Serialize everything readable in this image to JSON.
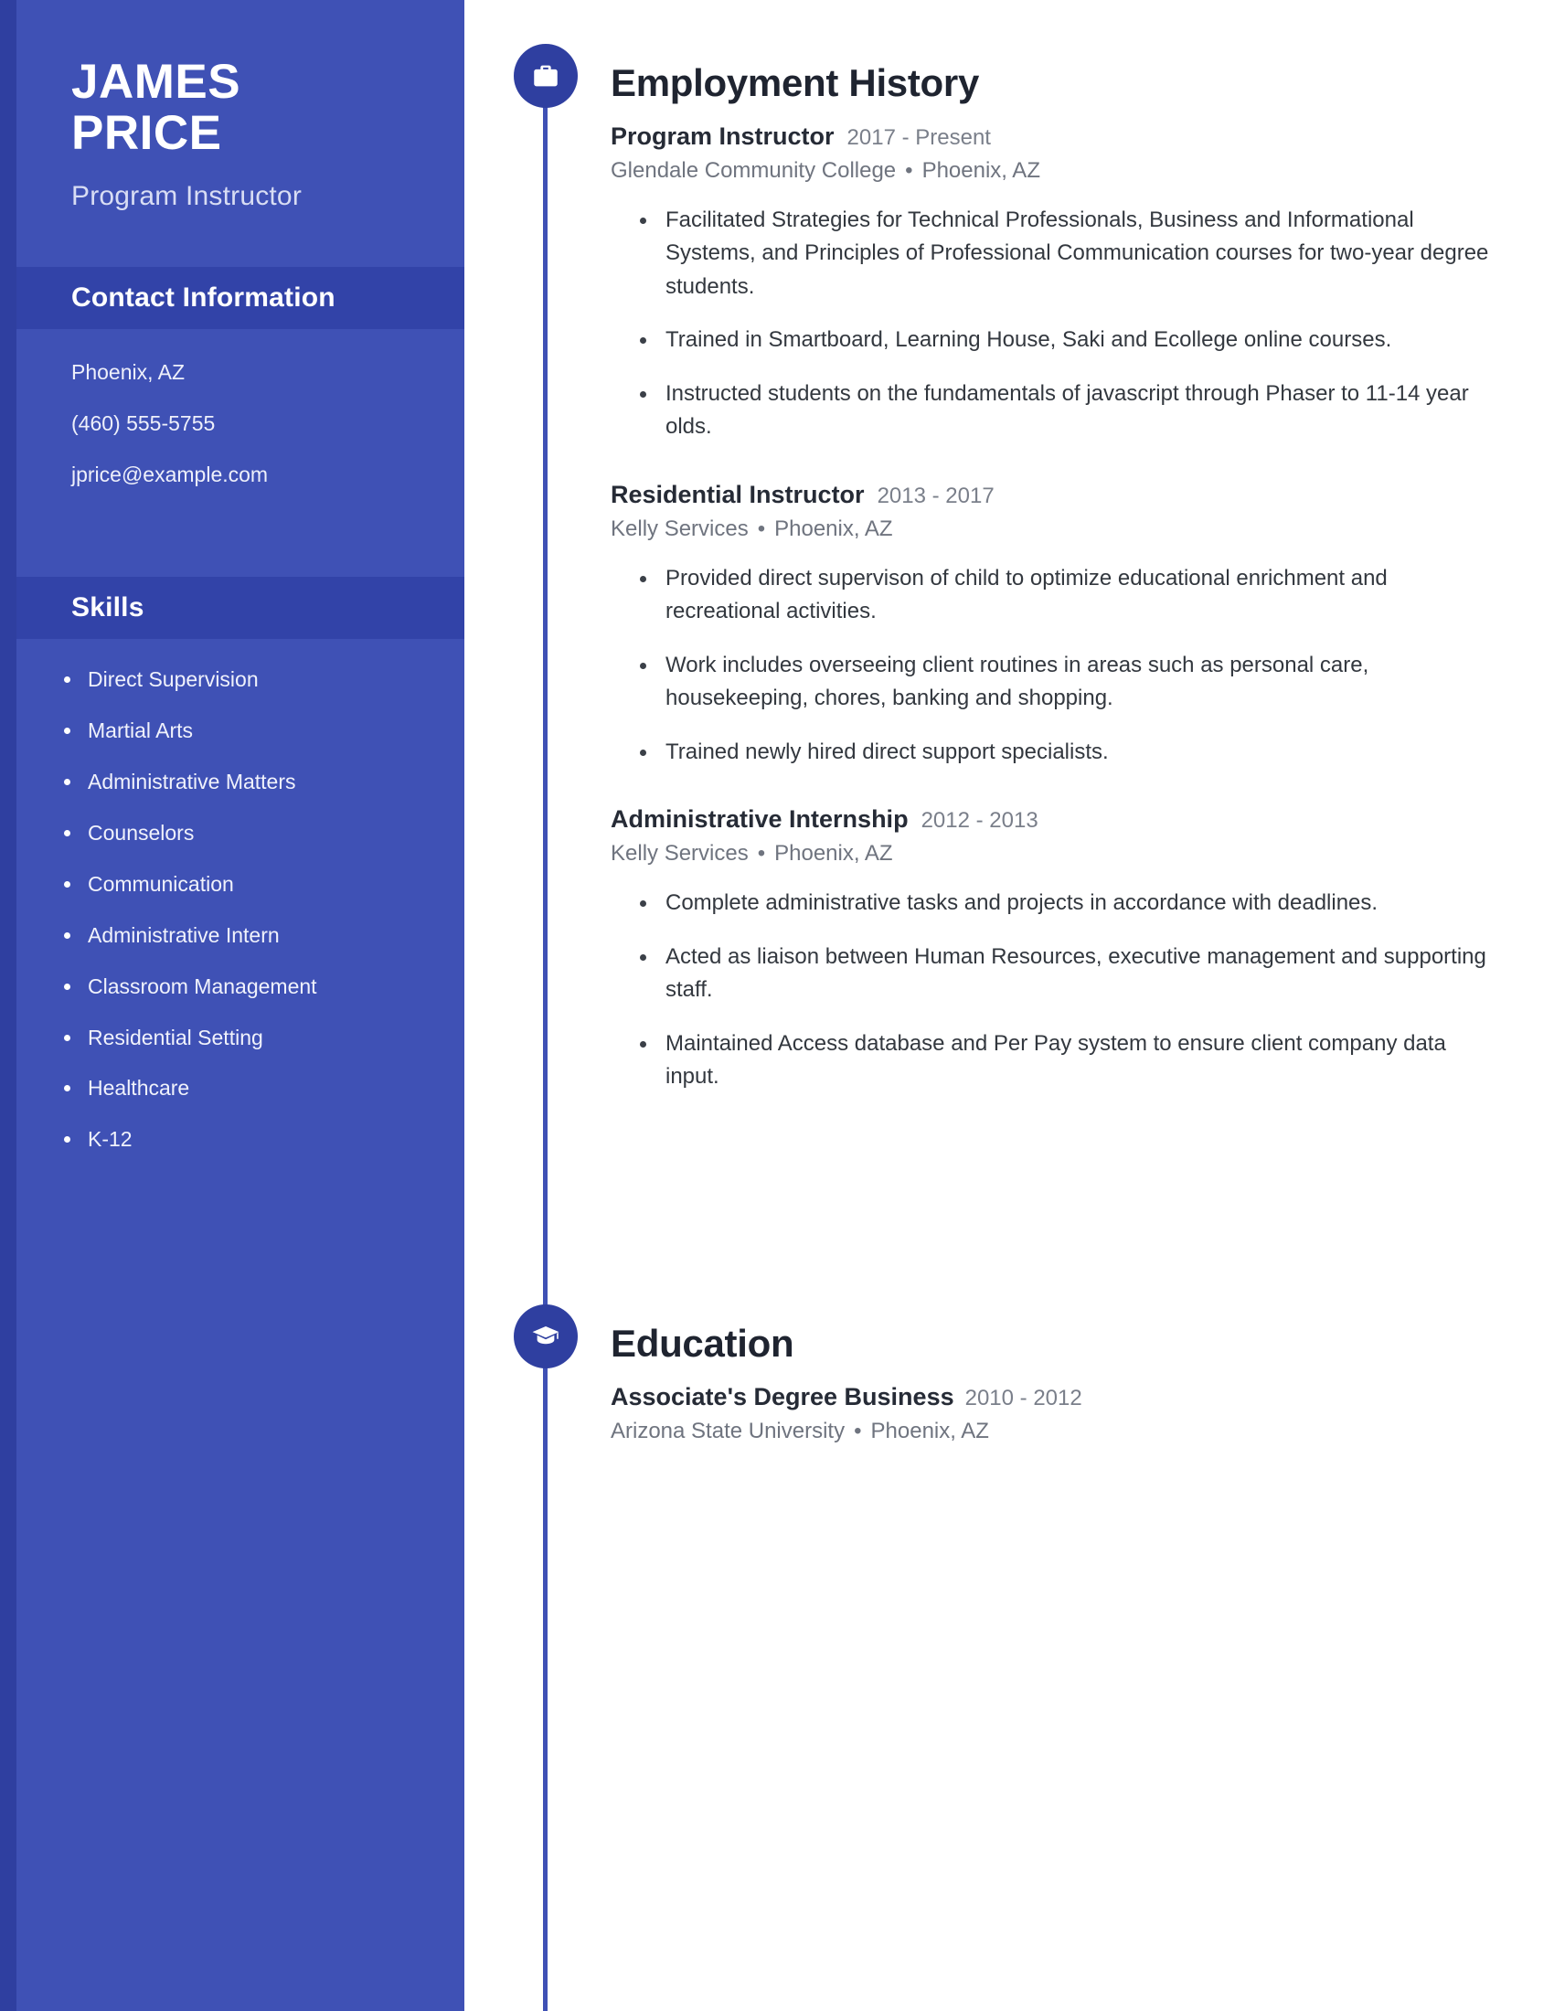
{
  "theme": {
    "sidebar_bg": "#3f51b5",
    "sidebar_band_bg": "#3243a8",
    "accent_dark": "#2f3fa0",
    "text_dark": "#262b36",
    "text_muted": "#6f747f"
  },
  "sidebar": {
    "name_first": "JAMES",
    "name_last": "PRICE",
    "job_title": "Program Instructor",
    "contact": {
      "heading": "Contact Information",
      "items": [
        "Phoenix, AZ",
        "(460) 555-5755",
        "jprice@example.com"
      ]
    },
    "skills": {
      "heading": "Skills",
      "items": [
        "Direct Supervision",
        "Martial Arts",
        "Administrative Matters",
        "Counselors",
        "Communication",
        "Administrative Intern",
        "Classroom Management",
        "Residential Setting",
        "Healthcare",
        "K-12"
      ]
    }
  },
  "main": {
    "employment": {
      "title": "Employment History",
      "icon": "briefcase-icon",
      "entries": [
        {
          "role": "Program Instructor",
          "dates": "2017 - Present",
          "company": "Glendale Community College",
          "separator": "•",
          "location": "Phoenix, AZ",
          "bullets": [
            "Facilitated Strategies for Technical Professionals, Business and Informational Systems, and Principles of Professional Communication courses for two-year degree students.",
            "Trained in Smartboard, Learning House, Saki and Ecollege online courses.",
            "Instructed students on the fundamentals of javascript through Phaser to 11-14 year olds."
          ]
        },
        {
          "role": "Residential Instructor",
          "dates": "2013 - 2017",
          "company": "Kelly Services",
          "separator": "•",
          "location": "Phoenix, AZ",
          "bullets": [
            "Provided direct supervison of child to optimize educational enrichment and recreational activities.",
            "Work includes overseeing client routines in areas such as personal care, housekeeping, chores, banking and shopping.",
            "Trained newly hired direct support specialists."
          ]
        },
        {
          "role": "Administrative Internship",
          "dates": "2012 - 2013",
          "company": "Kelly Services",
          "separator": "•",
          "location": "Phoenix, AZ",
          "bullets": [
            "Complete administrative tasks and projects in accordance with deadlines.",
            "Acted as liaison between Human Resources, executive management and supporting staff.",
            "Maintained Access database and Per Pay system to ensure client company data input."
          ]
        }
      ]
    },
    "education": {
      "title": "Education",
      "icon": "graduation-cap-icon",
      "entries": [
        {
          "degree": "Associate's Degree Business",
          "dates": "2010 - 2012",
          "school": "Arizona State University",
          "separator": "•",
          "location": "Phoenix, AZ"
        }
      ]
    }
  }
}
